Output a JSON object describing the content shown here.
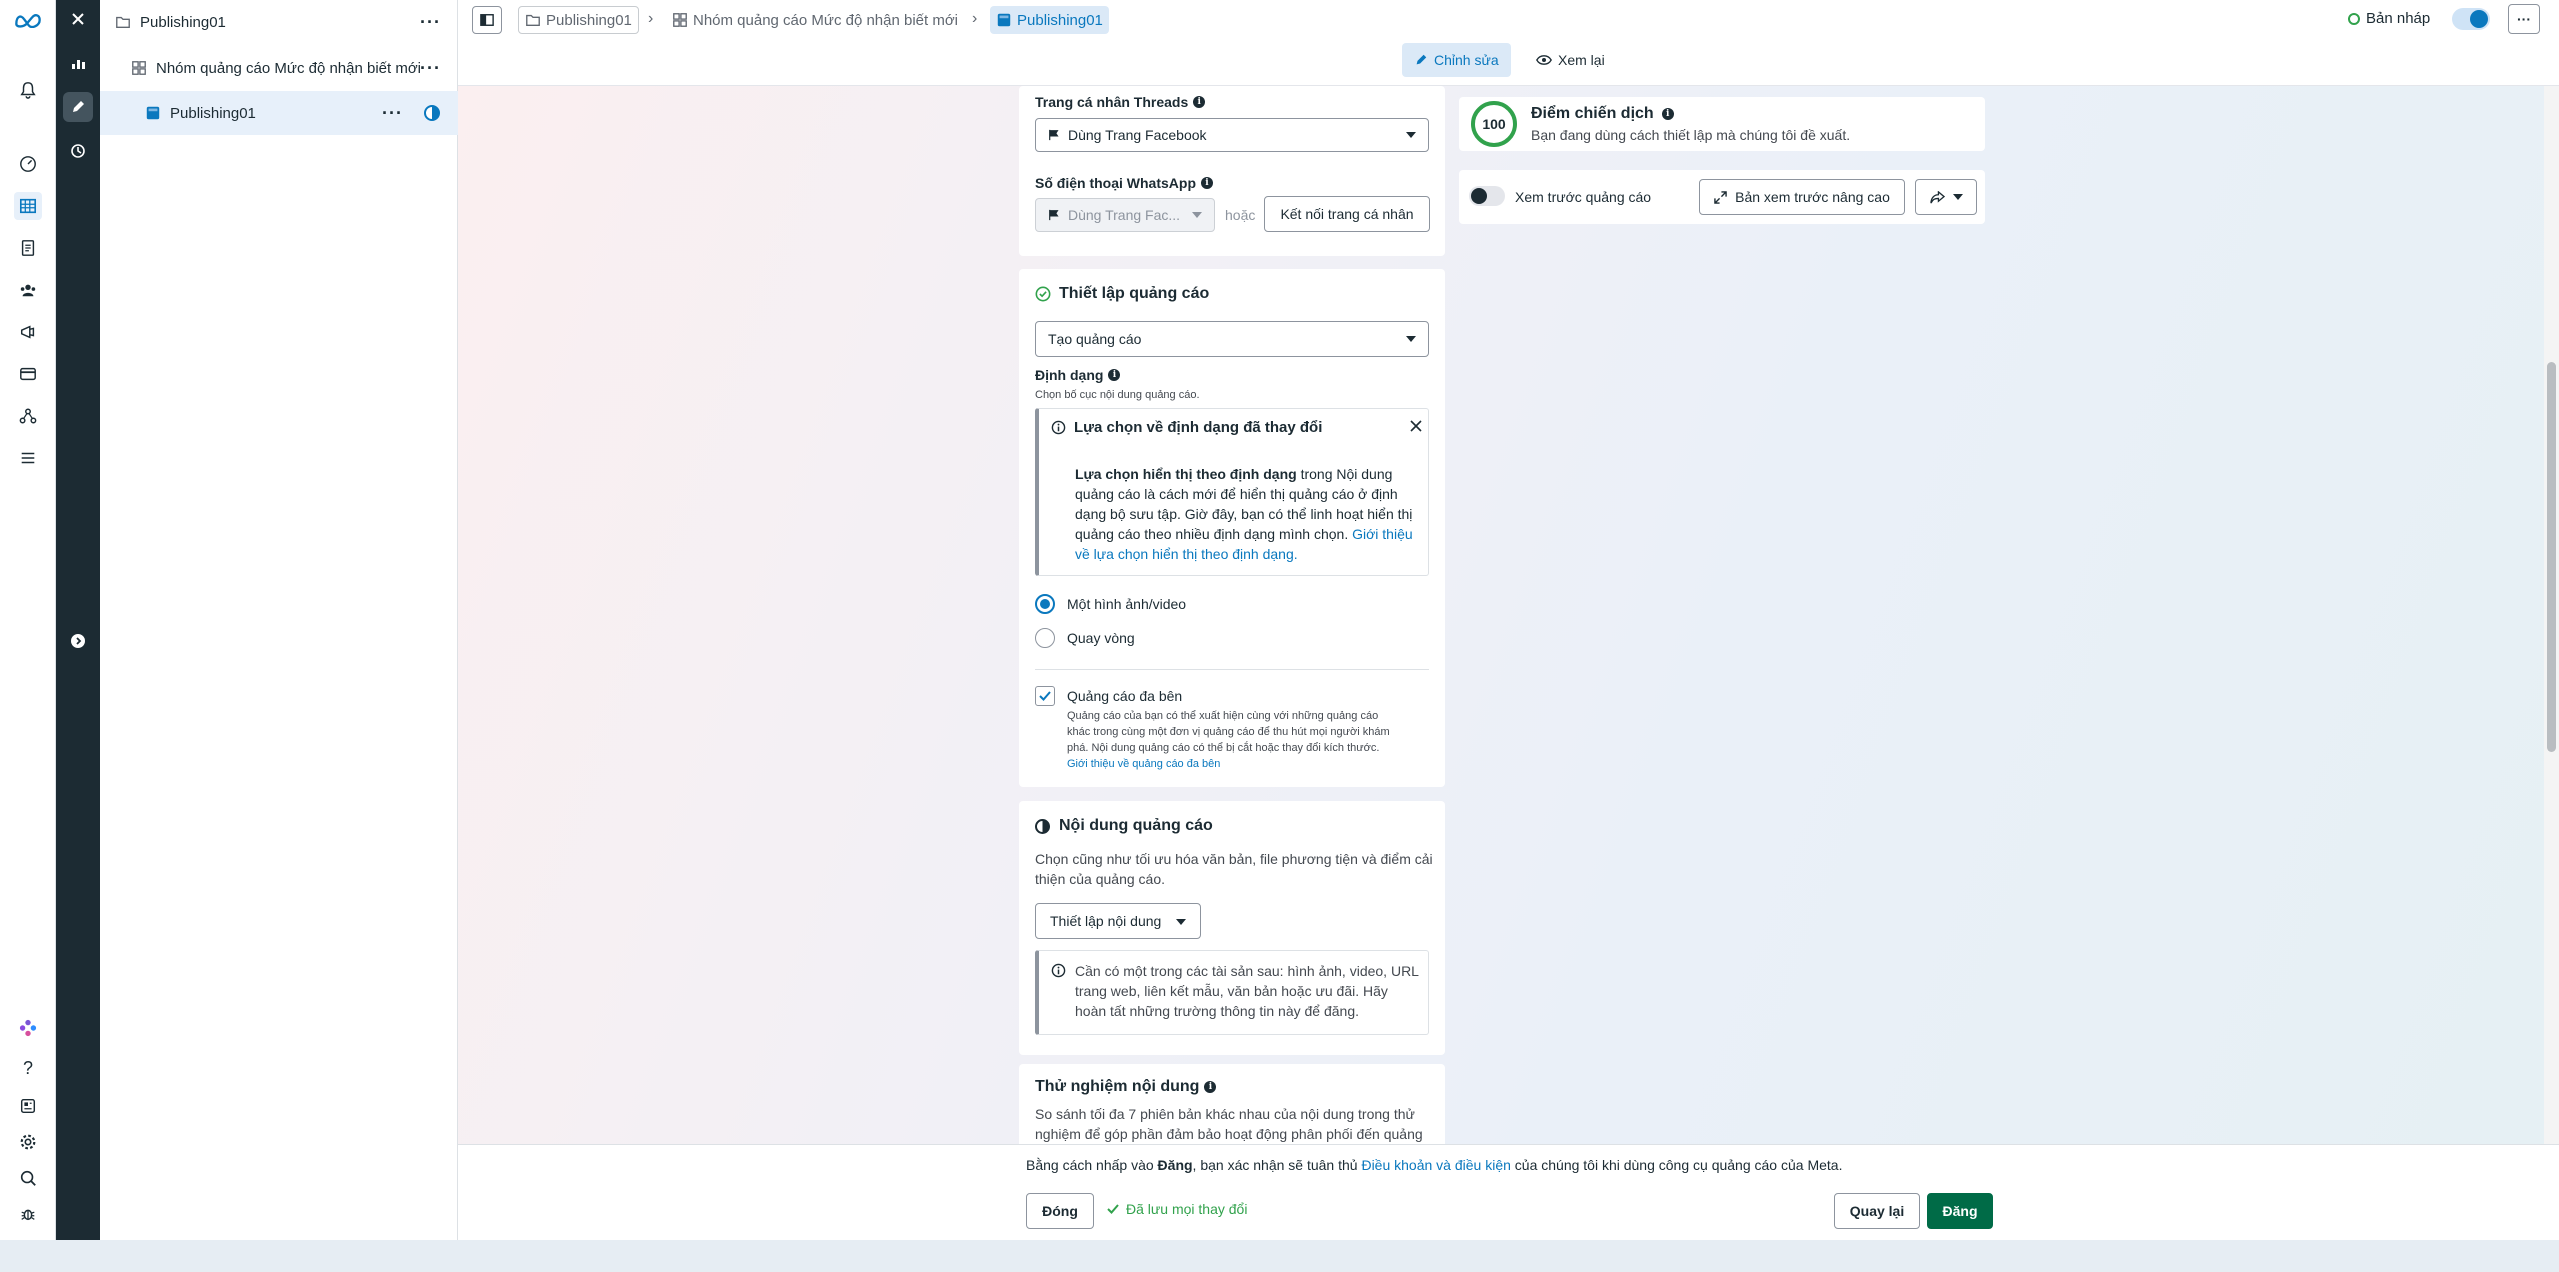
{
  "tree": {
    "campaign": "Publishing01",
    "adset": "Nhóm quảng cáo Mức độ nhận biết mới",
    "ad": "Publishing01"
  },
  "breadcrumb": {
    "campaign": "Publishing01",
    "adset": "Nhóm quảng cáo Mức độ nhận biết mới",
    "ad": "Publishing01"
  },
  "topbar": {
    "status": "Bản nháp",
    "edit_tab": "Chỉnh sửa",
    "review_tab": "Xem lại"
  },
  "identity": {
    "threads_label": "Trang cá nhân Threads",
    "threads_value": "Dùng Trang Facebook",
    "whatsapp_label": "Số điện thoại WhatsApp",
    "whatsapp_value": "Dùng Trang Fac...",
    "or": "hoặc",
    "connect_button": "Kết nối trang cá nhân"
  },
  "ad_setup": {
    "title": "Thiết lập quảng cáo",
    "create_value": "Tạo quảng cáo",
    "format_label": "Định dạng",
    "format_hint": "Chọn bố cục nội dung quảng cáo.",
    "notice_title": "Lựa chọn về định dạng đã thay đổi",
    "notice_bold": "Lựa chọn hiển thị theo định dạng",
    "notice_body_1": " trong Nội dung",
    "notice_body_2": "quảng cáo là cách mới để hiển thị quảng cáo ở định",
    "notice_body_3": "dạng bộ sưu tập. Giờ đây, bạn có thể linh hoạt hiển thị",
    "notice_body_4": "quảng cáo theo nhiều định dạng mình chọn. ",
    "notice_link_1": "Giới thiệu",
    "notice_link_2": "về lựa chọn hiển thị theo định dạng.",
    "option_single": "Một hình ảnh/video",
    "option_carousel": "Quay vòng",
    "multi_title": "Quảng cáo đa bên",
    "multi_desc_1": "Quảng cáo của bạn có thể xuất hiện cùng với những quảng cáo",
    "multi_desc_2": "khác trong cùng một đơn vị quảng cáo để thu hút mọi người khám",
    "multi_desc_3": "phá. Nội dung quảng cáo có thể bị cắt hoặc thay đổi kích thước.",
    "multi_link": "Giới thiệu về quảng cáo đa bên"
  },
  "creative": {
    "title": "Nội dung quảng cáo",
    "desc_1": "Chọn cũng như tối ưu hóa văn bản, file phương tiện và điểm cải",
    "desc_2": "thiện của quảng cáo.",
    "setup_button": "Thiết lập nội dung",
    "notice_1": "Cần có một trong các tài sản sau: hình ảnh, video, URL",
    "notice_2": "trang web, liên kết mẫu, văn bản hoặc ưu đãi. Hãy",
    "notice_3": "hoàn tất những trường thông tin này để đăng."
  },
  "testing": {
    "title": "Thử nghiệm nội dung",
    "desc_1": "So sánh tối đa 7 phiên bản khác nhau của nội dung trong thử",
    "desc_2": "nghiệm để góp phần đảm bảo hoạt động phân phối đến quảng"
  },
  "score": {
    "value": "100",
    "title": "Điểm chiến dịch",
    "desc": "Bạn đang dùng cách thiết lập mà chúng tôi đề xuất."
  },
  "preview": {
    "toggle_label": "Xem trước quảng cáo",
    "advanced_button": "Bản xem trước nâng cao"
  },
  "bottom": {
    "terms_1": "Bằng cách nhấp vào ",
    "terms_bold": "Đăng",
    "terms_2": ", bạn xác nhận sẽ tuân thủ ",
    "terms_link": "Điều khoản và điều kiện",
    "terms_3": " của chúng tôi khi dùng công cụ quảng cáo của Meta.",
    "close_button": "Đóng",
    "saved": "Đã lưu mọi thay đổi",
    "back_button": "Quay lại",
    "publish_button": "Đăng"
  },
  "colors": {
    "accent": "#0a78be",
    "publish": "#006b47",
    "rail_dark": "#1c2b33"
  }
}
